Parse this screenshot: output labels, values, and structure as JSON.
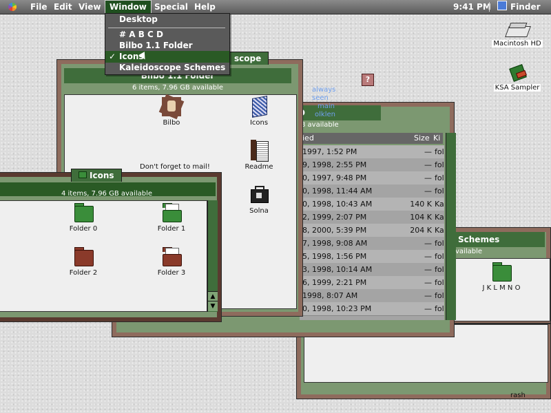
{
  "menubar": {
    "items": [
      "File",
      "Edit",
      "View",
      "Window",
      "Special",
      "Help"
    ],
    "clock": "9:41 PM",
    "app": "Finder"
  },
  "window_menu": {
    "items": [
      "Desktop",
      "# A B C D",
      "Bilbo 1.1 Folder",
      "Icons",
      "Kaleidoscope Schemes"
    ],
    "checked": "✓"
  },
  "bilbo_window": {
    "title": "Bilbo 1.1 Folder",
    "title_fragment": "scope",
    "info": "6 items, 7.96 GB available",
    "items": [
      "Bilbo",
      "Icons",
      "Readme",
      "Solna"
    ],
    "note": "Don't forget to mail!"
  },
  "icons_window": {
    "title": "Icons",
    "info": "4 items, 7.96 GB available",
    "items": [
      "Folder 0",
      "Folder 1",
      "Folder 2",
      "Folder 3"
    ]
  },
  "list_window": {
    "title_fragment": "D",
    "info": "8 available",
    "help_text": [
      "always seen",
      "main",
      "olklen"
    ],
    "columns": [
      "ied",
      "Size",
      "Ki"
    ],
    "rows": [
      {
        "date": "1997, 1:52 PM",
        "size": "—",
        "kind": "fol"
      },
      {
        "date": "9, 1998, 2:55 PM",
        "size": "—",
        "kind": "fol"
      },
      {
        "date": "0, 1997, 9:48 PM",
        "size": "—",
        "kind": "fol"
      },
      {
        "date": "0, 1998, 11:44 AM",
        "size": "—",
        "kind": "fol"
      },
      {
        "date": "0, 1998, 10:43 AM",
        "size": "140 K",
        "kind": "Ka"
      },
      {
        "date": "2, 1999, 2:07 PM",
        "size": "104 K",
        "kind": "Ka"
      },
      {
        "date": "8, 2000, 5:39 PM",
        "size": "204 K",
        "kind": "Ka"
      },
      {
        "date": "7, 1998, 9:08 AM",
        "size": "—",
        "kind": "fol"
      },
      {
        "date": "5, 1998, 1:56 PM",
        "size": "—",
        "kind": "fol"
      },
      {
        "date": "3, 1998, 10:14 AM",
        "size": "—",
        "kind": "fol"
      },
      {
        "date": "6, 1999, 2:21 PM",
        "size": "—",
        "kind": "fol"
      },
      {
        "date": "1998, 8:07 AM",
        "size": "—",
        "kind": "fol"
      },
      {
        "date": "0, 1998, 10:23 PM",
        "size": "—",
        "kind": "fol"
      }
    ]
  },
  "kaleido_window": {
    "title_fragment": "Schemes",
    "info": "vailable",
    "items": [
      "J K L M N O"
    ]
  },
  "bottom_window": {
    "fragment": "rash"
  },
  "desktop": {
    "items": [
      "Macintosh HD",
      "KSA Sampler"
    ]
  },
  "colors": {
    "accent_green": "#3f6d3b",
    "frame_brown": "#8e6b5d",
    "menu_gray": "#5a5a5a"
  }
}
